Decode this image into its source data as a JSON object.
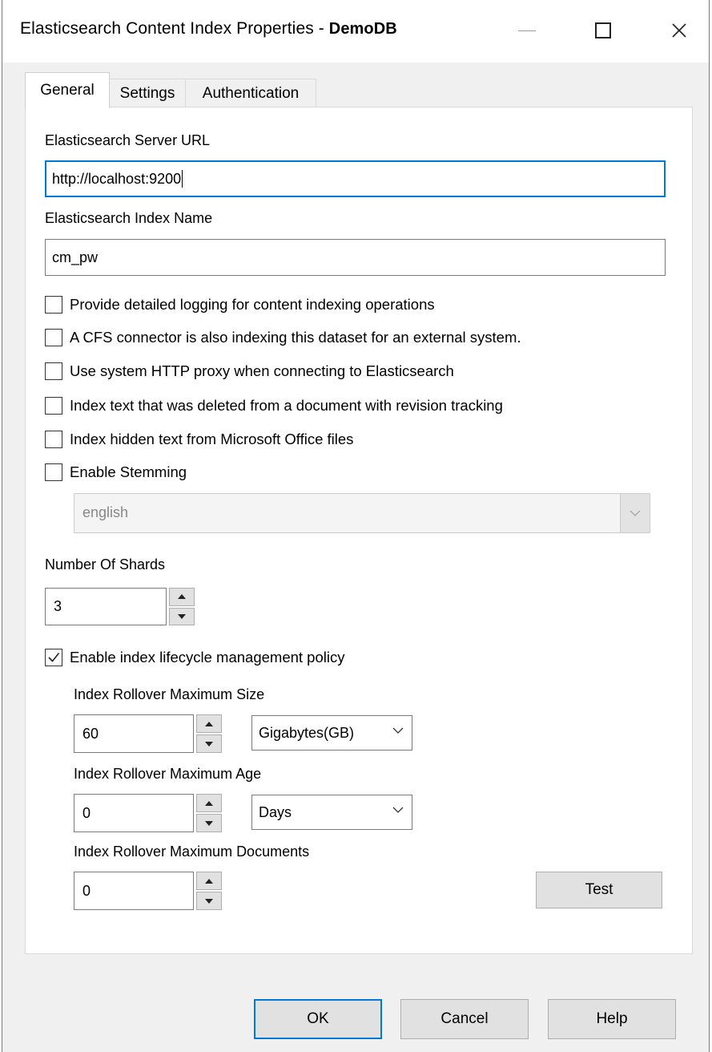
{
  "window": {
    "title": "Elasticsearch Content Index Properties - ",
    "title_db": "DemoDB",
    "close_glyph": "✕"
  },
  "tabs": [
    {
      "label": "General",
      "active": true
    },
    {
      "label": "Settings",
      "active": false
    },
    {
      "label": "Authentication",
      "active": false
    }
  ],
  "general": {
    "server_url_label": "Elasticsearch Server URL",
    "server_url_value": "http://localhost:9200",
    "index_name_label": "Elasticsearch Index Name",
    "index_name_value": "cm_pw",
    "options": [
      {
        "label": "Provide detailed logging for content indexing operations",
        "checked": false
      },
      {
        "label": "A CFS connector is also indexing this dataset for an external system.",
        "checked": false
      },
      {
        "label": "Use system HTTP proxy when connecting to Elasticsearch",
        "checked": false
      },
      {
        "label": "Index text that was deleted from a document with revision tracking",
        "checked": false
      },
      {
        "label": "Index hidden text from Microsoft Office files",
        "checked": false
      },
      {
        "label": "Enable Stemming",
        "checked": false
      }
    ],
    "stemming_language": "english",
    "shards_label": "Number Of Shards",
    "shards_value": "3",
    "ilm_label": "Enable index lifecycle management policy",
    "ilm_checked": true,
    "max_size_label": "Index Rollover Maximum Size",
    "max_size_value": "60",
    "max_size_unit": "Gigabytes(GB)",
    "max_age_label": "Index Rollover Maximum Age",
    "max_age_value": "0",
    "max_age_unit": "Days",
    "max_docs_label": "Index Rollover Maximum Documents",
    "max_docs_value": "0",
    "test_label": "Test"
  },
  "footer": {
    "ok_label": "OK",
    "cancel_label": "Cancel",
    "help_label": "Help"
  },
  "colors": {
    "focus_border": "#0078d7",
    "dialog_bg": "#f0f0f0",
    "button_bg": "#e1e1e1"
  }
}
